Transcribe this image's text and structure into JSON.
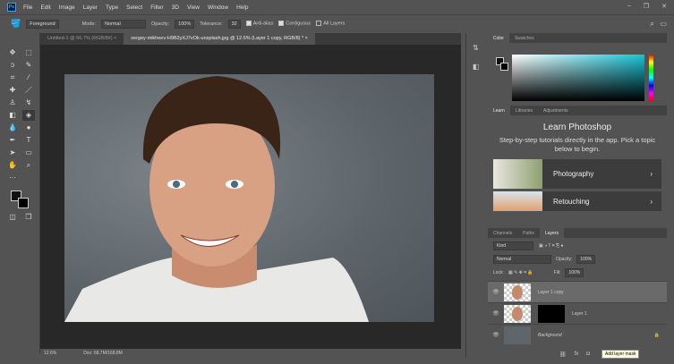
{
  "app": {
    "logo": "Ps",
    "menu": [
      "File",
      "Edit",
      "Image",
      "Layer",
      "Type",
      "Select",
      "Filter",
      "3D",
      "View",
      "Window",
      "Help"
    ]
  },
  "options": {
    "tool_preset": "Foreground",
    "mode_label": "Mode:",
    "mode": "Normal",
    "opacity_label": "Opacity:",
    "opacity": "100%",
    "tolerance_label": "Tolerance:",
    "tolerance": "32",
    "anti_alias": "Anti-alias",
    "contiguous": "Contiguous",
    "all_layers": "All Layers"
  },
  "tabs": [
    {
      "label": "Untitled-1 @ 66.7% (RGB/8#)",
      "active": false
    },
    {
      "label": "sergey-mikheev-H9B2yXJ7vOk-unsplash.jpg @ 12.6% (Layer 1 copy, RGB/8) *",
      "active": true
    }
  ],
  "status": {
    "zoom": "12.6%",
    "doc": "Doc: 68.7M/168.8M"
  },
  "color_panel": {
    "tabs": [
      "Color",
      "Swatches"
    ],
    "hue": "#19c3d6"
  },
  "learn": {
    "tabs": [
      "Learn",
      "Libraries",
      "Adjustments"
    ],
    "title": "Learn Photoshop",
    "desc": "Step-by-step tutorials directly in the app. Pick a topic below to begin.",
    "cards": [
      "Photography",
      "Retouching"
    ]
  },
  "layers": {
    "tabs": [
      "Channels",
      "Paths",
      "Layers"
    ],
    "kind": "Kind",
    "blend": "Normal",
    "opacity_label": "Opacity:",
    "opacity": "100%",
    "lock_label": "Lock:",
    "fill_label": "Fill:",
    "fill": "100%",
    "items": [
      {
        "name": "Layer 1 copy",
        "selected": true
      },
      {
        "name": "Layer 1",
        "selected": false
      },
      {
        "name": "Background",
        "selected": false
      }
    ],
    "tooltip": "Add layer mask"
  }
}
